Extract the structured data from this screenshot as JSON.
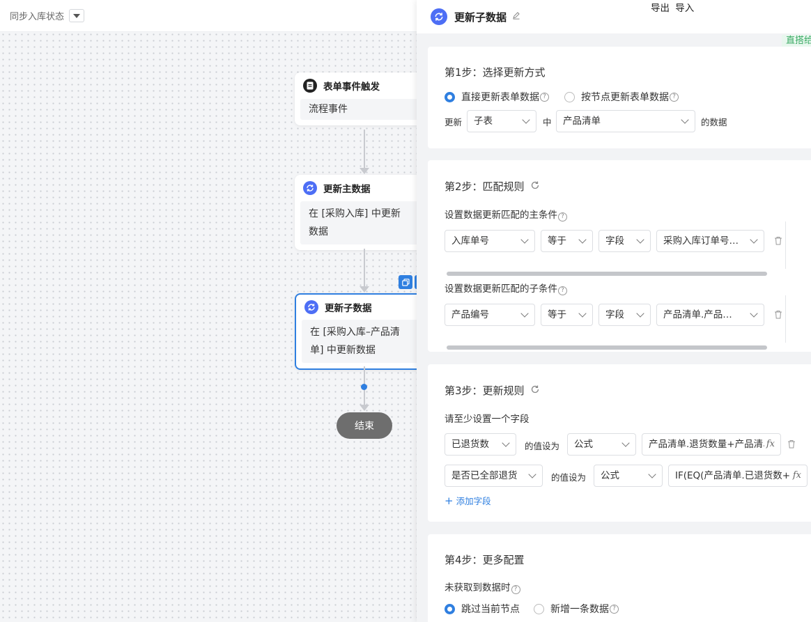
{
  "topbar": {
    "title": "同步入库状态"
  },
  "flow": {
    "trigger": {
      "title": "表单事件触发",
      "body": "流程事件"
    },
    "update_main": {
      "title": "更新主数据",
      "body": "在 [采购入库] 中更新数据"
    },
    "update_sub": {
      "title": "更新子数据",
      "body": "在 [采购入库–产品清单] 中更新数据"
    },
    "end": {
      "label": "结束"
    }
  },
  "panel": {
    "title": "更新子数据",
    "export": "导出",
    "import": "导入",
    "tag": "直搭给",
    "step1": {
      "title": "第1步：选择更新方式",
      "option_direct": "直接更新表单数据",
      "option_node": "按节点更新表单数据",
      "update_label": "更新",
      "table_type": "子表",
      "mid_label": "中",
      "table_name": "产品清单",
      "suffix": "的数据"
    },
    "step2": {
      "title": "第2步：匹配规则",
      "main_cond_label": "设置数据更新匹配的主条件",
      "main_cond": {
        "field": "入库单号",
        "op": "等于",
        "type": "字段",
        "value": "采购入库订单号…"
      },
      "sub_cond_label": "设置数据更新匹配的子条件",
      "sub_cond": {
        "field": "产品编号",
        "op": "等于",
        "type": "字段",
        "value": "产品清单.产品…"
      }
    },
    "step3": {
      "title": "第3步：更新规则",
      "hint": "请至少设置一个字段",
      "rows": [
        {
          "field": "已退货数",
          "set_label": "的值设为",
          "mode": "公式",
          "formula": "产品清单.退货数量+产品清单"
        },
        {
          "field": "是否已全部退货",
          "set_label": "的值设为",
          "mode": "公式",
          "formula": "IF(EQ(产品清单.已退货数+"
        }
      ],
      "add_field": "添加字段"
    },
    "step4": {
      "title": "第4步：更多配置",
      "not_found_label": "未获取到数据时",
      "option_skip": "跳过当前节点",
      "option_add": "新增一条数据"
    }
  },
  "colors": {
    "accent": "#2f7fe0",
    "node_icon": "#4d6ef5",
    "tag_green": "#3aaa63"
  }
}
